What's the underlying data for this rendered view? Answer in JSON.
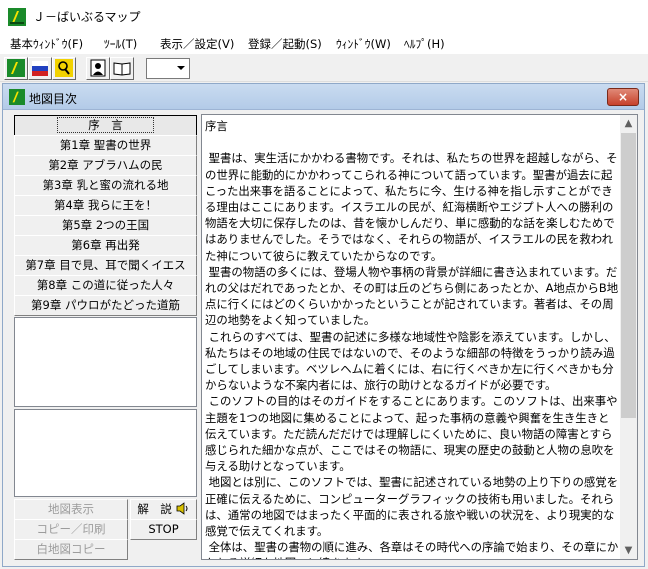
{
  "app": {
    "title": "Ｊ－ばいぶるマップ"
  },
  "menu": [
    "基本ｳｨﾝﾄﾞｳ(F)",
    "ﾂｰﾙ(T)",
    "表示／設定(V)",
    "登録／起動(S)",
    "ｳｨﾝﾄﾞｳ(W)",
    "ﾍﾙﾌﾟ(H)"
  ],
  "toolbar": {
    "icons": [
      "app-logo-icon",
      "flag-icon",
      "magnifier-icon",
      "person-icon",
      "book-icon"
    ],
    "combo_value": ""
  },
  "window": {
    "title": "地図目次",
    "close_label": "×"
  },
  "chapters": [
    "序　言",
    "第1章 聖書の世界",
    "第2章 アブラハムの民",
    "第3章 乳と蜜の流れる地",
    "第4章 我らに王を！",
    "第5章 2つの王国",
    "第6章 再出発",
    "第7章 目で見、耳で聞くイエス",
    "第8章 この道に従った人々",
    "第9章 パウロがたどった道筋"
  ],
  "buttons": {
    "map_display": "地図表示",
    "copy_print": "コピー／印刷",
    "white_map_copy": "白地図コピー",
    "commentary": "解　説",
    "stop": "STOP"
  },
  "text": {
    "body": "序言\n\n 聖書は、実生活にかかわる書物です。それは、私たちの世界を超越しながら、その世界に能動的にかかわってこられる神について語っています。聖書が過去に起こった出来事を語ることによって、私たちに今、生ける神を指し示すことができる理由はここにあります。イスラエルの民が、紅海横断やエジプト人への勝利の物語を大切に保存したのは、昔を懐かしんだり、単に感動的な話を楽しむためではありませんでした。そうではなく、それらの物語が、イスラエルの民を救われた神について彼らに教えていたからなのです。\n 聖書の物語の多くには、登場人物や事柄の背景が詳細に書き込まれています。だれの父はだれであったとか、その町は丘のどちら側にあったとか、A地点からB地点に行くにはどのくらいかかったということが記されています。著者は、その周辺の地勢をよく知っていました。\n これらのすべては、聖書の記述に多様な地域性や陰影を添えています。しかし、私たちはその地域の住民ではないので、そのような細部の特徴をうっかり読み過ごしてしまいます。ベツレヘムに着くには、右に行くべきか左に行くべきかも分からないような不案内者には、旅行の助けとなるガイドが必要です。\n このソフトの目的はそのガイドをすることにあります。このソフトは、出来事や主題を1つの地図に集めることによって、起った事柄の意義や興奮を生き生きと伝えています。ただ読んだだけでは理解しにくいために、良い物語の障害とすら感じられた細かな点が、ここではその物語に、現実の歴史の鼓動と人物の息吹を与える助けとなっています。\n 地図とは別に、このソフトでは、聖書に記述されている地勢の上り下りの感覚を正確に伝えるために、コンピューターグラフィックの技術も用いました。それらは、通常の地図ではまったく平面的に表される旅や戦いの状況を、より現実的な感覚で伝えてくれます。\n 全体は、聖書の書物の順に進み、各章はその時代への序論で始まり、その章にかかわる詳細な地図へと続きます。"
  }
}
